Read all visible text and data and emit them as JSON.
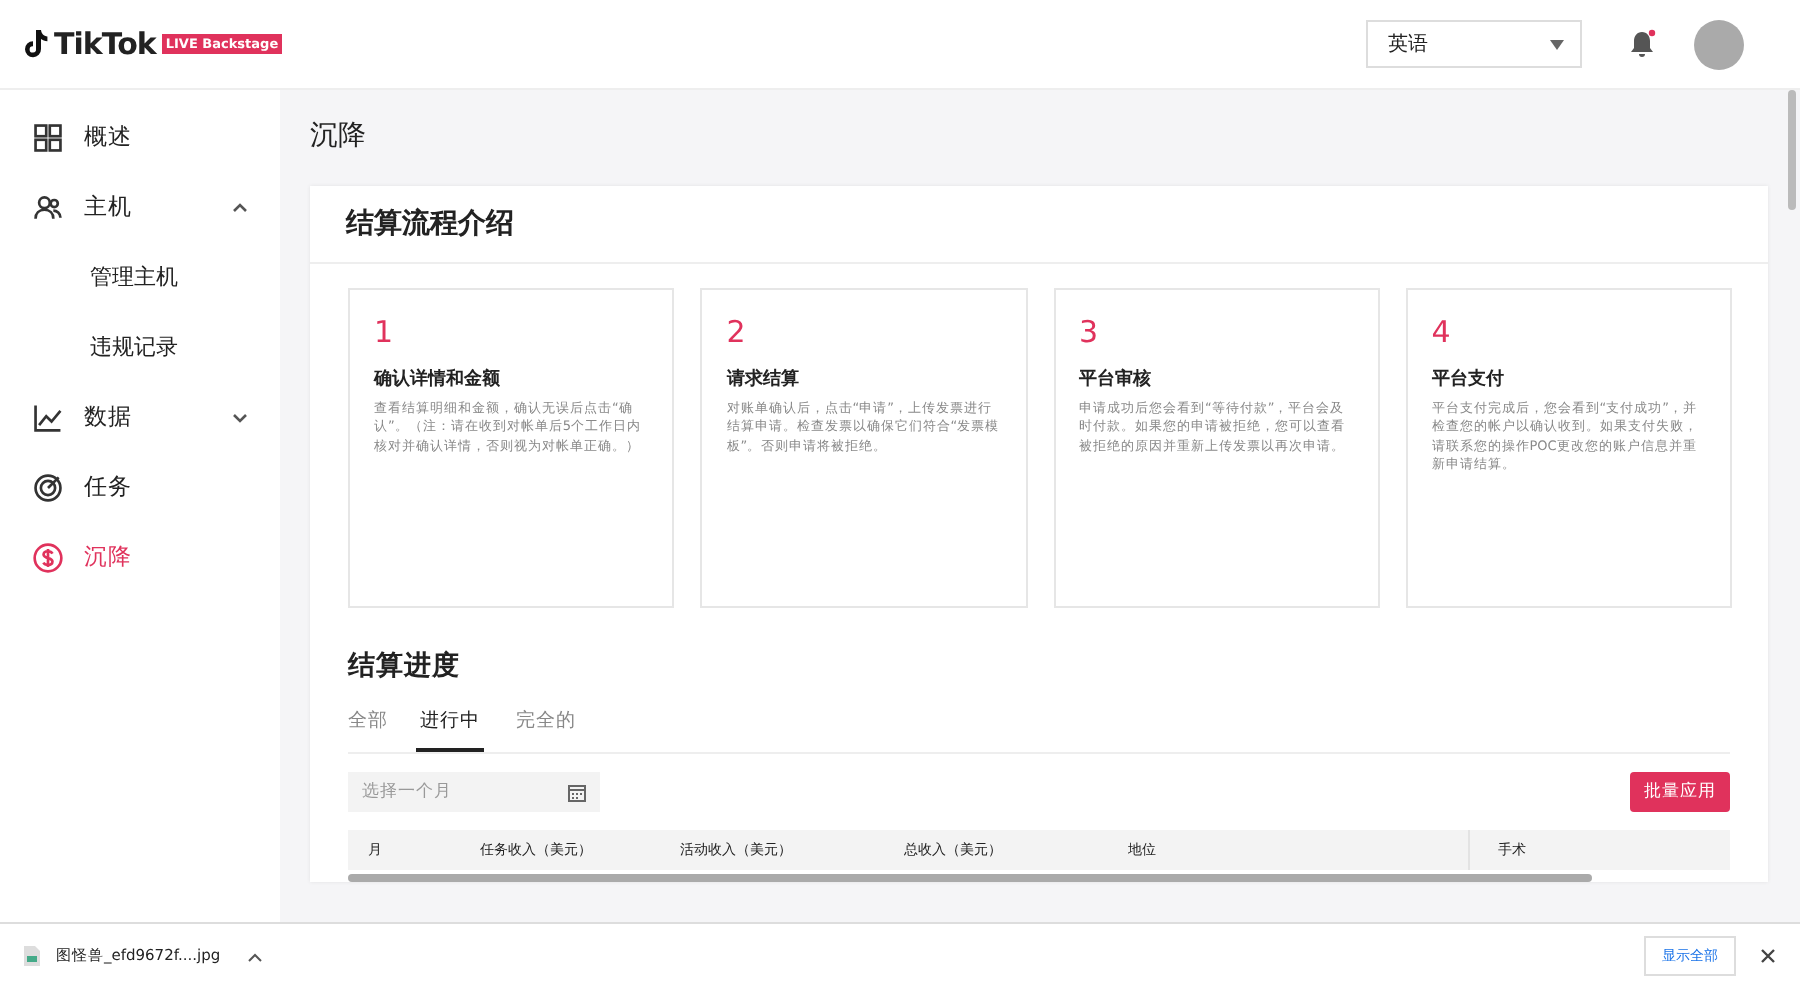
{
  "header": {
    "logo": {
      "wordmark": "TikTok",
      "badge": "LIVE Backstage"
    },
    "language_select": {
      "value": "英语"
    },
    "notifications": {
      "unread": true
    }
  },
  "sidebar": {
    "items": [
      {
        "label": "概述",
        "kind": "grid",
        "selected": false
      },
      {
        "label": "主机",
        "kind": "people",
        "selected": false,
        "expanded": true,
        "children": [
          {
            "label": "管理主机",
            "selected": false
          },
          {
            "label": "违规记录",
            "selected": false
          }
        ]
      },
      {
        "label": "数据",
        "kind": "chart",
        "selected": false,
        "expanded": false
      },
      {
        "label": "任务",
        "kind": "target",
        "selected": false
      },
      {
        "label": "沉降",
        "kind": "dollar",
        "selected": true
      }
    ]
  },
  "page_title": "沉降",
  "intro": {
    "title": "结算流程介绍",
    "steps": [
      {
        "number": "1",
        "title": "确认详情和金额",
        "text": "查看结算明细和金额，确认无误后点击“确认”。（注：请在收到对帐单后5个工作日内核对并确认详情，否则视为对帐单正确。）"
      },
      {
        "number": "2",
        "title": "请求结算",
        "text": "对账单确认后，点击“申请”，上传发票进行结算申请。检查发票以确保它们符合“发票模板”。否则申请将被拒绝。"
      },
      {
        "number": "3",
        "title": "平台审核",
        "text": "申请成功后您会看到“等待付款”，平台会及时付款。如果您的申请被拒绝，您可以查看被拒绝的原因并重新上传发票以再次申请。"
      },
      {
        "number": "4",
        "title": "平台支付",
        "text": "平台支付完成后，您会看到“支付成功”，并检查您的帐户以确认收到。如果支付失败，请联系您的操作POC更改您的账户信息并重新申请结算。"
      }
    ]
  },
  "progress": {
    "title": "结算进度",
    "tabs": [
      {
        "label": "全部",
        "selected": false
      },
      {
        "label": "进行中",
        "selected": true
      },
      {
        "label": "完全的",
        "selected": false
      }
    ],
    "month_picker": {
      "placeholder": "选择一个月"
    },
    "batch_button": "批量应用",
    "table": {
      "columns": [
        "月",
        "任务收入（美元）",
        "活动收入（美元）",
        "总收入（美元）",
        "地位",
        "手术"
      ]
    }
  },
  "download_bar": {
    "file": "图怪兽_efd9672f....jpg",
    "show_all": "显示全部"
  }
}
